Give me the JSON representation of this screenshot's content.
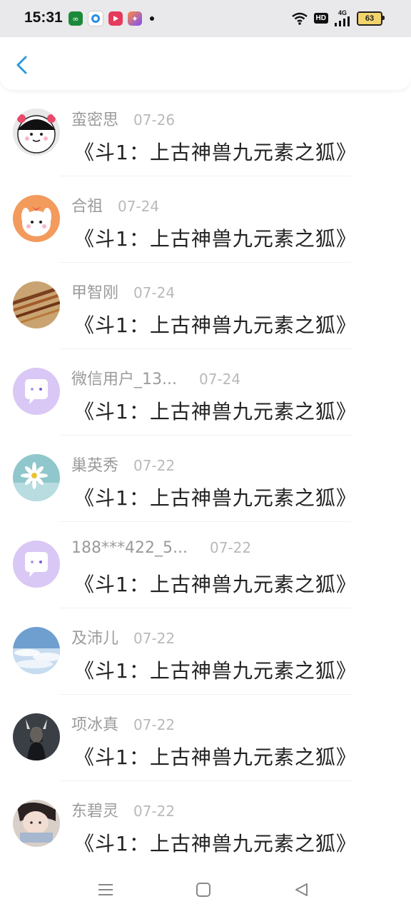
{
  "status_bar": {
    "time": "15:31",
    "hd_label": "HD",
    "network_label": "4G",
    "battery": "63"
  },
  "comments": [
    {
      "name": "蛮密思",
      "date": "07-26",
      "text": "《斗1：上古神兽九元素之狐》"
    },
    {
      "name": "合祖",
      "date": "07-24",
      "text": "《斗1：上古神兽九元素之狐》"
    },
    {
      "name": "甲智刚",
      "date": "07-24",
      "text": "《斗1：上古神兽九元素之狐》"
    },
    {
      "name": "微信用户_13...",
      "date": "07-24",
      "text": "《斗1：上古神兽九元素之狐》"
    },
    {
      "name": "巢英秀",
      "date": "07-22",
      "text": "《斗1：上古神兽九元素之狐》"
    },
    {
      "name": "188***422_5...",
      "date": "07-22",
      "text": "《斗1：上古神兽九元素之狐》"
    },
    {
      "name": "及沛儿",
      "date": "07-22",
      "text": "《斗1：上古神兽九元素之狐》"
    },
    {
      "name": "项冰真",
      "date": "07-22",
      "text": "《斗1：上古神兽九元素之狐》"
    },
    {
      "name": "东碧灵",
      "date": "07-22",
      "text": "《斗1：上古神兽九元素之狐》"
    }
  ],
  "colors": {
    "accent": "#2f9bd9",
    "name_gray": "#9b9b9b",
    "date_gray": "#b9b9b9"
  },
  "icons": {
    "back": "chevron-left-icon",
    "nav_menu": "menu-icon",
    "nav_home": "home-square-icon",
    "nav_back": "back-triangle-icon"
  }
}
